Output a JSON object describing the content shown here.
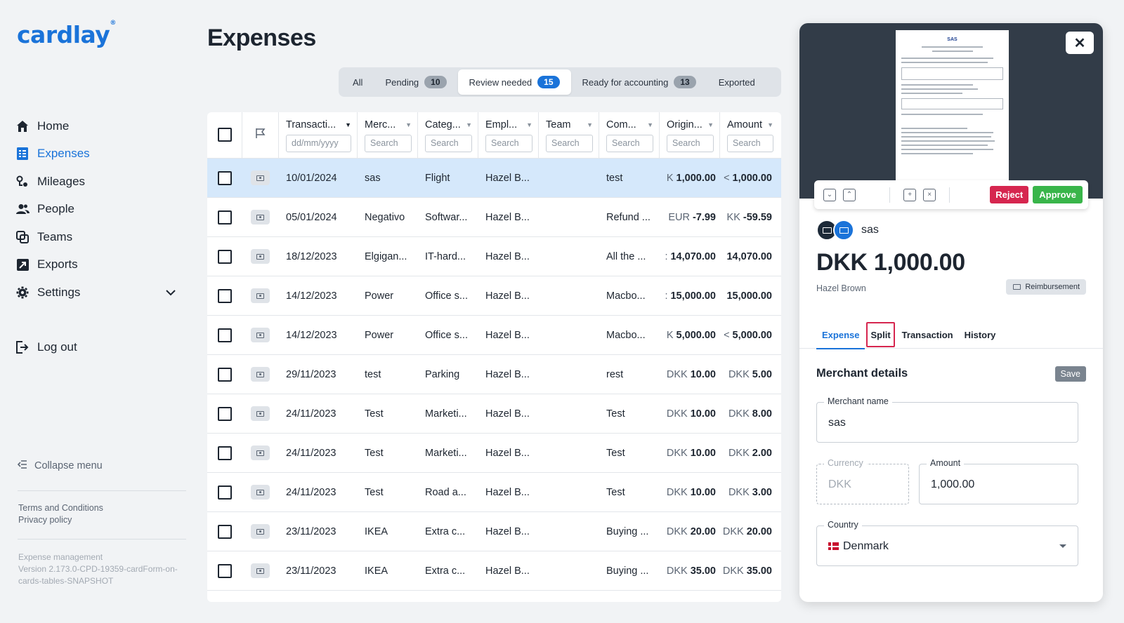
{
  "brand": {
    "logo": "cardlay",
    "accent": "#1a73d9"
  },
  "nav": {
    "items": [
      {
        "label": "Home",
        "icon": "home-icon"
      },
      {
        "label": "Expenses",
        "icon": "receipt-icon",
        "active": true
      },
      {
        "label": "Mileages",
        "icon": "route-icon"
      },
      {
        "label": "People",
        "icon": "people-icon"
      },
      {
        "label": "Teams",
        "icon": "teams-icon"
      },
      {
        "label": "Exports",
        "icon": "export-icon"
      },
      {
        "label": "Settings",
        "icon": "gear-icon"
      }
    ],
    "logout": "Log out",
    "collapse": "Collapse menu",
    "terms": "Terms and Conditions",
    "privacy": "Privacy policy",
    "version": "Expense management\nVersion 2.173.0-CPD-19359-cardForm-on-cards-tables-SNAPSHOT"
  },
  "page": {
    "title": "Expenses"
  },
  "tabs": [
    {
      "label": "All"
    },
    {
      "label": "Pending",
      "count": "10"
    },
    {
      "label": "Review needed",
      "count": "15",
      "active": true
    },
    {
      "label": "Ready for accounting",
      "count": "13"
    },
    {
      "label": "Exported"
    }
  ],
  "table": {
    "columns": [
      {
        "label": "Transacti...",
        "filter": "dd/mm/yyyy"
      },
      {
        "label": "Merc...",
        "filter": "Search"
      },
      {
        "label": "Categ...",
        "filter": "Search"
      },
      {
        "label": "Empl...",
        "filter": "Search"
      },
      {
        "label": "Team",
        "filter": "Search"
      },
      {
        "label": "Com...",
        "filter": "Search"
      },
      {
        "label": "Origin...",
        "filter": "Search"
      },
      {
        "label": "Amount",
        "filter": "Search"
      }
    ],
    "rows": [
      {
        "date": "10/01/2024",
        "merchant": "sas",
        "category": "Flight",
        "employee": "Hazel B...",
        "team": "",
        "comment": "test",
        "orig_cur": "K",
        "orig_amt": "1,000.00",
        "cur": "<",
        "amt": "1,000.00",
        "selected": true
      },
      {
        "date": "05/01/2024",
        "merchant": "Negativo",
        "category": "Softwar...",
        "employee": "Hazel B...",
        "team": "",
        "comment": "Refund ...",
        "orig_cur": "EUR",
        "orig_amt": "-7.99",
        "cur": "KK",
        "amt": "-59.59"
      },
      {
        "date": "18/12/2023",
        "merchant": "Elgigan...",
        "category": "IT-hard...",
        "employee": "Hazel B...",
        "team": "",
        "comment": "All the ...",
        "orig_cur": ":",
        "orig_amt": "14,070.00",
        "cur": "",
        "amt": "14,070.00"
      },
      {
        "date": "14/12/2023",
        "merchant": "Power",
        "category": "Office s...",
        "employee": "Hazel B...",
        "team": "",
        "comment": "Macbo...",
        "orig_cur": ":",
        "orig_amt": "15,000.00",
        "cur": "",
        "amt": "15,000.00"
      },
      {
        "date": "14/12/2023",
        "merchant": "Power",
        "category": "Office s...",
        "employee": "Hazel B...",
        "team": "",
        "comment": "Macbo...",
        "orig_cur": "K",
        "orig_amt": "5,000.00",
        "cur": "<",
        "amt": "5,000.00"
      },
      {
        "date": "29/11/2023",
        "merchant": "test",
        "category": "Parking",
        "employee": "Hazel B...",
        "team": "",
        "comment": "rest",
        "orig_cur": "DKK",
        "orig_amt": "10.00",
        "cur": "DKK",
        "amt": "5.00"
      },
      {
        "date": "24/11/2023",
        "merchant": "Test",
        "category": "Marketi...",
        "employee": "Hazel B...",
        "team": "",
        "comment": "Test",
        "orig_cur": "DKK",
        "orig_amt": "10.00",
        "cur": "DKK",
        "amt": "8.00"
      },
      {
        "date": "24/11/2023",
        "merchant": "Test",
        "category": "Marketi...",
        "employee": "Hazel B...",
        "team": "",
        "comment": "Test",
        "orig_cur": "DKK",
        "orig_amt": "10.00",
        "cur": "DKK",
        "amt": "2.00"
      },
      {
        "date": "24/11/2023",
        "merchant": "Test",
        "category": "Road a...",
        "employee": "Hazel B...",
        "team": "",
        "comment": "Test",
        "orig_cur": "DKK",
        "orig_amt": "10.00",
        "cur": "DKK",
        "amt": "3.00"
      },
      {
        "date": "23/11/2023",
        "merchant": "IKEA",
        "category": "Extra c...",
        "employee": "Hazel B...",
        "team": "",
        "comment": "Buying ...",
        "orig_cur": "DKK",
        "orig_amt": "20.00",
        "cur": "DKK",
        "amt": "20.00"
      },
      {
        "date": "23/11/2023",
        "merchant": "IKEA",
        "category": "Extra c...",
        "employee": "Hazel B...",
        "team": "",
        "comment": "Buying ...",
        "orig_cur": "DKK",
        "orig_amt": "35.00",
        "cur": "DKK",
        "amt": "35.00"
      }
    ]
  },
  "detail": {
    "close": "✕",
    "reject": "Reject",
    "approve": "Approve",
    "merchant": "sas",
    "amount": "DKK 1,000.00",
    "employee": "Hazel Brown",
    "type": "Reimbursement",
    "tabs": [
      "Expense",
      "Split",
      "Transaction",
      "History"
    ],
    "section_title": "Merchant details",
    "save": "Save",
    "fields": {
      "merchant_label": "Merchant name",
      "merchant_value": "sas",
      "currency_label": "Currency",
      "currency_value": "DKK",
      "amount_label": "Amount",
      "amount_value": "1,000.00",
      "country_label": "Country",
      "country_value": "Denmark"
    },
    "receipt_logo": "SAS"
  }
}
